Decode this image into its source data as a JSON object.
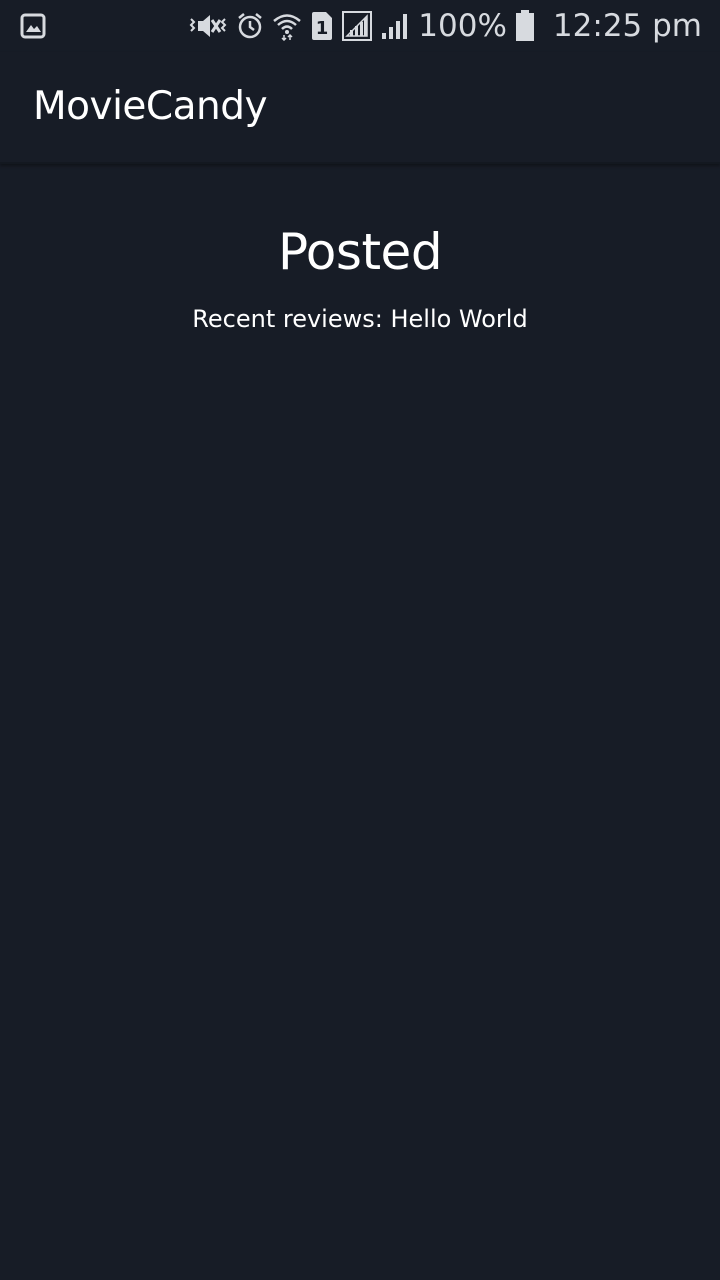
{
  "status_bar": {
    "left_icons": [
      "gallery-notification-icon"
    ],
    "right_icons": [
      "vibrate-icon",
      "alarm-icon",
      "wifi-icon",
      "sim-1-icon",
      "signal-icon",
      "signal-secondary-icon"
    ],
    "sim_label": "1",
    "battery_percent": "100%",
    "battery_icon": "battery-full-icon",
    "time": "12:25 pm"
  },
  "app_bar": {
    "title": "MovieCandy"
  },
  "main": {
    "heading": "Posted",
    "recent_reviews": "Recent reviews: Hello World"
  },
  "colors": {
    "background": "#171c26",
    "text": "#ffffff",
    "status_icons": "#d7dadf"
  }
}
